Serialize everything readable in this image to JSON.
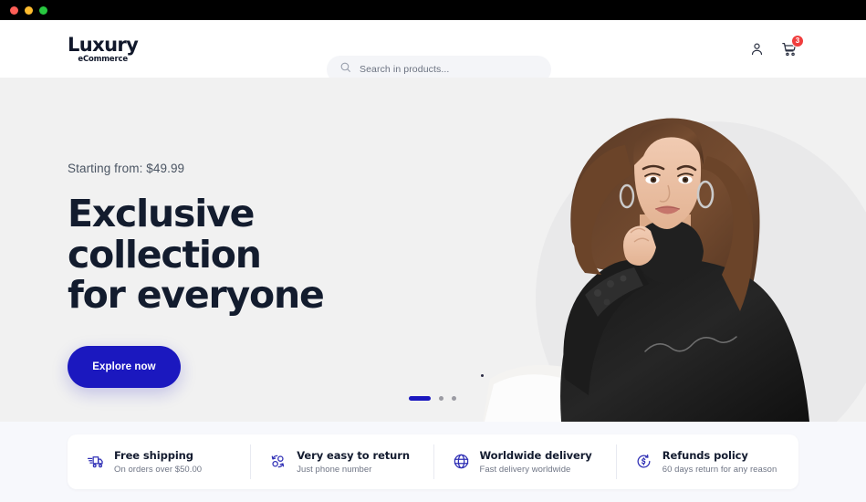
{
  "window": {
    "traffic_lights": [
      "close",
      "minimize",
      "maximize"
    ]
  },
  "header": {
    "logo_main": "Luxury",
    "logo_sub": "eCommerce",
    "search": {
      "placeholder": "Search in products...",
      "value": "",
      "icon": "search-icon"
    },
    "account_icon": "user-icon",
    "cart_icon": "shopping-cart-icon",
    "cart_count": "3",
    "badge_color": "#f03e3e"
  },
  "hero": {
    "eyebrow": "Starting from: $49.99",
    "title_line1": "Exclusive collection",
    "title_line2": "for everyone",
    "cta_label": "Explore now",
    "accent_color": "#1b18bf",
    "background_color": "#f1f1f1",
    "image_alt": "Woman in black turtleneck sweater",
    "carousel": {
      "active_index": 0,
      "slides": [
        "slide-1",
        "slide-2",
        "slide-3"
      ]
    }
  },
  "features": {
    "background_color": "#f7f8fc",
    "items": [
      {
        "icon": "delivery-truck-icon",
        "title": "Free shipping",
        "subtitle": "On orders over $50.00"
      },
      {
        "icon": "return-arrows-icon",
        "title": "Very easy to return",
        "subtitle": "Just phone number"
      },
      {
        "icon": "globe-icon",
        "title": "Worldwide delivery",
        "subtitle": "Fast delivery worldwide"
      },
      {
        "icon": "refund-dollar-icon",
        "title": "Refunds policy",
        "subtitle": "60 days return for any reason"
      }
    ]
  }
}
